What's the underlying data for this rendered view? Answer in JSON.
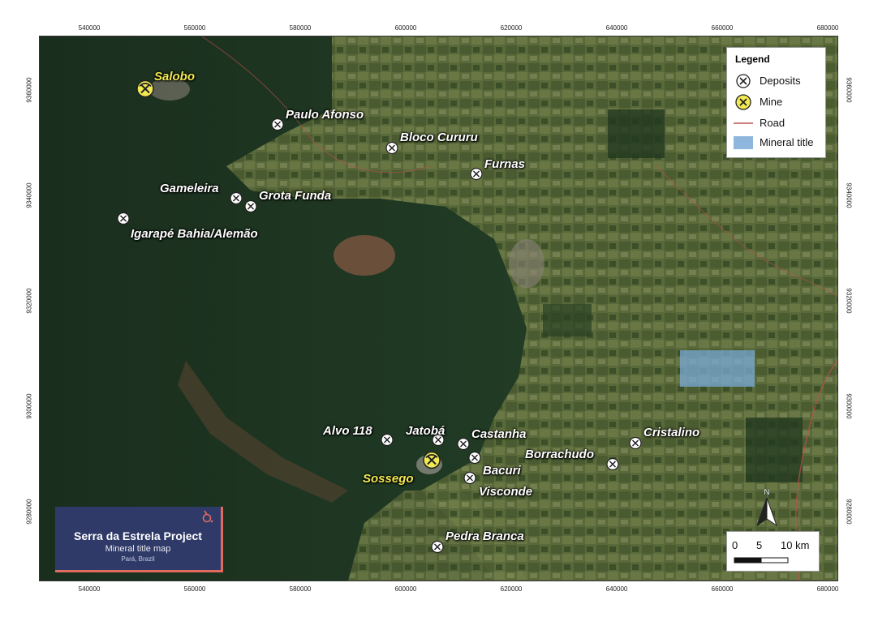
{
  "map": {
    "x_ticks": [
      "540000",
      "560000",
      "580000",
      "600000",
      "620000",
      "640000",
      "660000",
      "680000"
    ],
    "y_ticks": [
      "9360000",
      "9340000",
      "9320000",
      "9300000",
      "9280000"
    ],
    "colors": {
      "forest": "#1f3a22",
      "farmland": "#5b6b3a",
      "road": "#c0504d",
      "mineral_title": "#78aad7",
      "mine_label": "#f3ea52",
      "title_box": "#2f3a68",
      "title_accent": "#e06b5e"
    }
  },
  "deposits": [
    {
      "name": "Paulo Afonso"
    },
    {
      "name": "Bloco Cururu"
    },
    {
      "name": "Furnas"
    },
    {
      "name": "Gameleira"
    },
    {
      "name": "Grota Funda"
    },
    {
      "name": "Igarapé Bahia/Alemão"
    },
    {
      "name": "Alvo 118"
    },
    {
      "name": "Jatobá"
    },
    {
      "name": "Castanha"
    },
    {
      "name": "Bacuri"
    },
    {
      "name": "Visconde"
    },
    {
      "name": "Borrachudo"
    },
    {
      "name": "Cristalino"
    },
    {
      "name": "Pedra Branca"
    }
  ],
  "mines": [
    {
      "name": "Salobo"
    },
    {
      "name": "Sossego"
    }
  ],
  "legend": {
    "title": "Legend",
    "items": [
      {
        "label": "Deposits",
        "icon": "pickaxe-white-icon"
      },
      {
        "label": "Mine",
        "icon": "pickaxe-yellow-icon"
      },
      {
        "label": "Road",
        "icon": "road-line-icon"
      },
      {
        "label": "Mineral title",
        "icon": "blue-rectangle-icon"
      }
    ]
  },
  "title_box": {
    "title": "Serra da Estrela Project",
    "subtitle": "Mineral title map",
    "location": "Pará, Brazil"
  },
  "scale_bar": {
    "labels": [
      "0",
      "5",
      "10 km"
    ]
  },
  "north_arrow": {
    "label": "N"
  }
}
